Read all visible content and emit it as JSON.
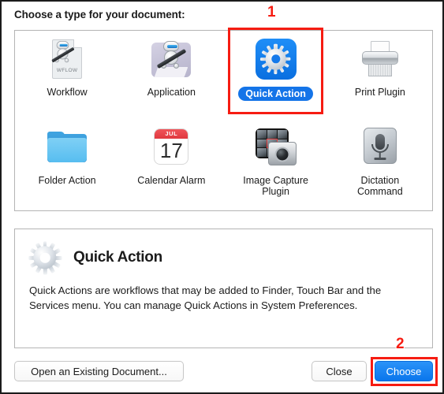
{
  "dialog": {
    "prompt_title": "Choose a type for your document:"
  },
  "type_grid": {
    "rows": [
      [
        {
          "label": "Workflow",
          "icon": "workflow-document-icon",
          "selected": false,
          "doc_text": "WFLOW"
        },
        {
          "label": "Application",
          "icon": "automator-robot-icon",
          "selected": false
        },
        {
          "label": "Quick Action",
          "icon": "quick-action-gear-icon",
          "selected": true
        },
        {
          "label": "Print Plugin",
          "icon": "printer-icon",
          "selected": false
        }
      ],
      [
        {
          "label": "Folder Action",
          "icon": "folder-icon",
          "selected": false
        },
        {
          "label": "Calendar Alarm",
          "icon": "calendar-icon",
          "selected": false,
          "cal_month": "JUL",
          "cal_day": "17"
        },
        {
          "label": "Image Capture\nPlugin",
          "icon": "image-capture-camera-icon",
          "selected": false
        },
        {
          "label": "Dictation\nCommand",
          "icon": "microphone-icon",
          "selected": false
        }
      ]
    ]
  },
  "description": {
    "icon": "quick-action-gear-icon",
    "title": "Quick Action",
    "body": "Quick Actions are workflows that may be added to Finder, Touch Bar and the Services menu. You can manage Quick Actions in System Preferences."
  },
  "footer": {
    "open_existing_label": "Open an Existing Document...",
    "close_label": "Close",
    "choose_label": "Choose"
  },
  "annotations": {
    "step_one": "1",
    "step_two": "2",
    "color": "#f61c12"
  },
  "colors": {
    "selection_blue": "#1474e8",
    "primary_button_blue": "#0a76ec",
    "annotation_red": "#f61c12",
    "panel_border": "#b4b4b4"
  }
}
